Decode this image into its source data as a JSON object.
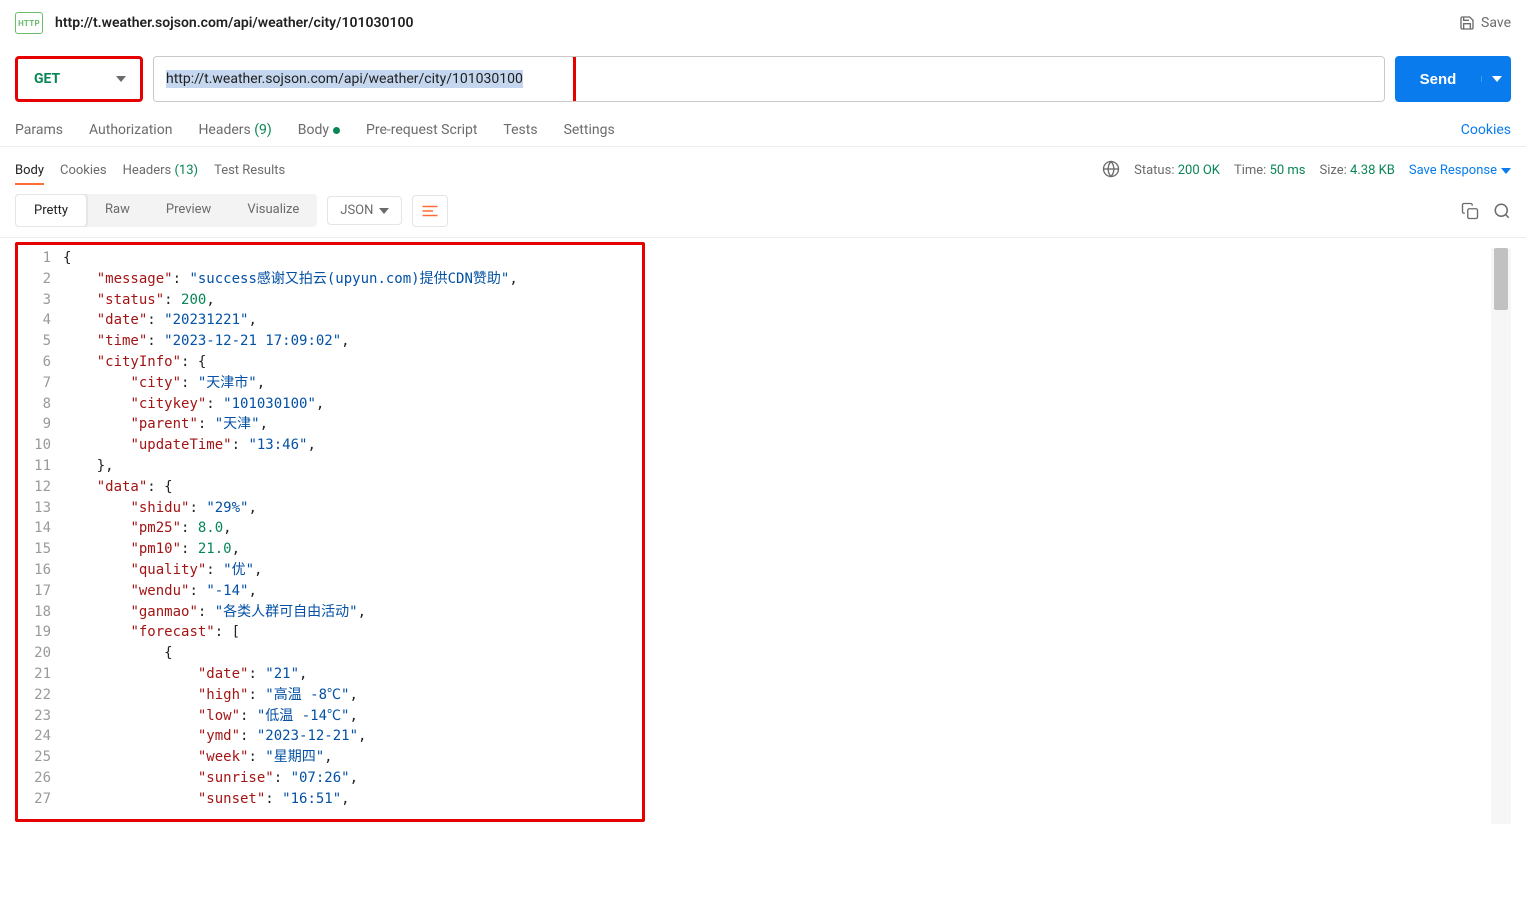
{
  "tab_title": "http://t.weather.sojson.com/api/weather/city/101030100",
  "save_label": "Save",
  "method": "GET",
  "url": "http://t.weather.sojson.com/api/weather/city/101030100",
  "send_label": "Send",
  "req_tabs": {
    "params": "Params",
    "auth": "Authorization",
    "headers": "Headers",
    "headers_count": "(9)",
    "body": "Body",
    "prs": "Pre-request Script",
    "tests": "Tests",
    "settings": "Settings"
  },
  "cookies_link": "Cookies",
  "resp_tabs": {
    "body": "Body",
    "cookies": "Cookies",
    "headers": "Headers",
    "headers_count": "(13)",
    "tr": "Test Results"
  },
  "meta": {
    "status_lbl": "Status:",
    "status_val": "200 OK",
    "time_lbl": "Time:",
    "time_val": "50 ms",
    "size_lbl": "Size:",
    "size_val": "4.38 KB"
  },
  "save_response": "Save Response",
  "fmt_tabs": {
    "pretty": "Pretty",
    "raw": "Raw",
    "preview": "Preview",
    "viz": "Visualize"
  },
  "json_label": "JSON",
  "lines": [
    "1",
    "2",
    "3",
    "4",
    "5",
    "6",
    "7",
    "8",
    "9",
    "10",
    "11",
    "12",
    "13",
    "14",
    "15",
    "16",
    "17",
    "18",
    "19",
    "20",
    "21",
    "22",
    "23",
    "24",
    "25",
    "26",
    "27"
  ],
  "code": {
    "l1": "{",
    "l2_k": "\"message\"",
    "l2_v": "\"success感谢又拍云(upyun.com)提供CDN赞助\"",
    "l3_k": "\"status\"",
    "l3_v": "200",
    "l4_k": "\"date\"",
    "l4_v": "\"20231221\"",
    "l5_k": "\"time\"",
    "l5_v": "\"2023-12-21 17:09:02\"",
    "l6_k": "\"cityInfo\"",
    "l7_k": "\"city\"",
    "l7_v": "\"天津市\"",
    "l8_k": "\"citykey\"",
    "l8_v": "\"101030100\"",
    "l9_k": "\"parent\"",
    "l9_v": "\"天津\"",
    "l10_k": "\"updateTime\"",
    "l10_v": "\"13:46\"",
    "l12_k": "\"data\"",
    "l13_k": "\"shidu\"",
    "l13_v": "\"29%\"",
    "l14_k": "\"pm25\"",
    "l14_v": "8.0",
    "l15_k": "\"pm10\"",
    "l15_v": "21.0",
    "l16_k": "\"quality\"",
    "l16_v": "\"优\"",
    "l17_k": "\"wendu\"",
    "l17_v": "\"-14\"",
    "l18_k": "\"ganmao\"",
    "l18_v": "\"各类人群可自由活动\"",
    "l19_k": "\"forecast\"",
    "l21_k": "\"date\"",
    "l21_v": "\"21\"",
    "l22_k": "\"high\"",
    "l22_v": "\"高温 -8℃\"",
    "l23_k": "\"low\"",
    "l23_v": "\"低温 -14℃\"",
    "l24_k": "\"ymd\"",
    "l24_v": "\"2023-12-21\"",
    "l25_k": "\"week\"",
    "l25_v": "\"星期四\"",
    "l26_k": "\"sunrise\"",
    "l26_v": "\"07:26\"",
    "l27_k": "\"sunset\"",
    "l27_v": "\"16:51\""
  }
}
